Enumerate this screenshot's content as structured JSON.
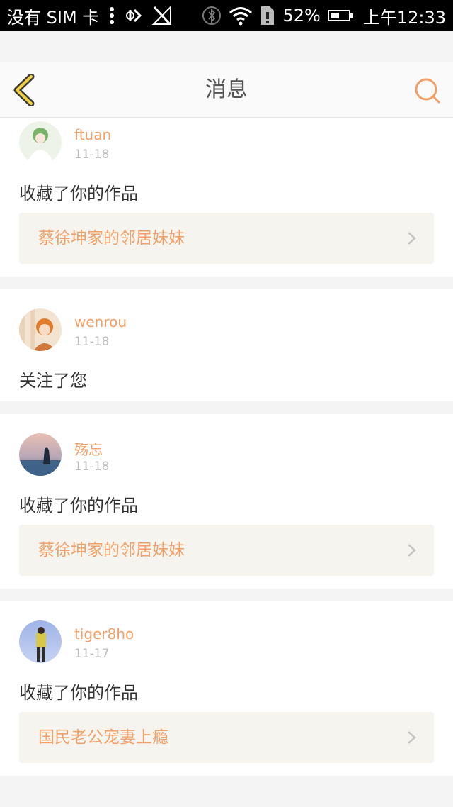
{
  "status_bar": {
    "carrier": "没有 SIM 卡",
    "battery_percent": "52%",
    "battery_level": 0.52,
    "time": "上午12:33",
    "icons": [
      "more-vert-icon",
      "data-sync-icon",
      "signal-off-icon",
      "bluetooth-icon",
      "wifi-icon",
      "no-sim-icon",
      "battery-icon"
    ]
  },
  "header": {
    "title": "消息",
    "back_icon": "chevron-left-icon",
    "search_icon": "search-icon",
    "accent_color": "#f0a068",
    "back_color": "#f3d040"
  },
  "messages": [
    {
      "user": "ftuan",
      "date": "11-18",
      "action": "收藏了你的作品",
      "work": "蔡徐坤家的邻居妹妹",
      "avatar": "avatar-anime-girl-white"
    },
    {
      "user": "wenrou",
      "date": "11-18",
      "action": "关注了您",
      "work": null,
      "avatar": "avatar-anime-boy-orange"
    },
    {
      "user": "殇忘",
      "date": "11-18",
      "action": "收藏了你的作品",
      "work": "蔡徐坤家的邻居妹妹",
      "avatar": "avatar-girl-beach-sunset"
    },
    {
      "user": "tiger8ho",
      "date": "11-17",
      "action": "收藏了你的作品",
      "work": "国民老公宠妻上瘾",
      "avatar": "avatar-man-sky"
    }
  ]
}
